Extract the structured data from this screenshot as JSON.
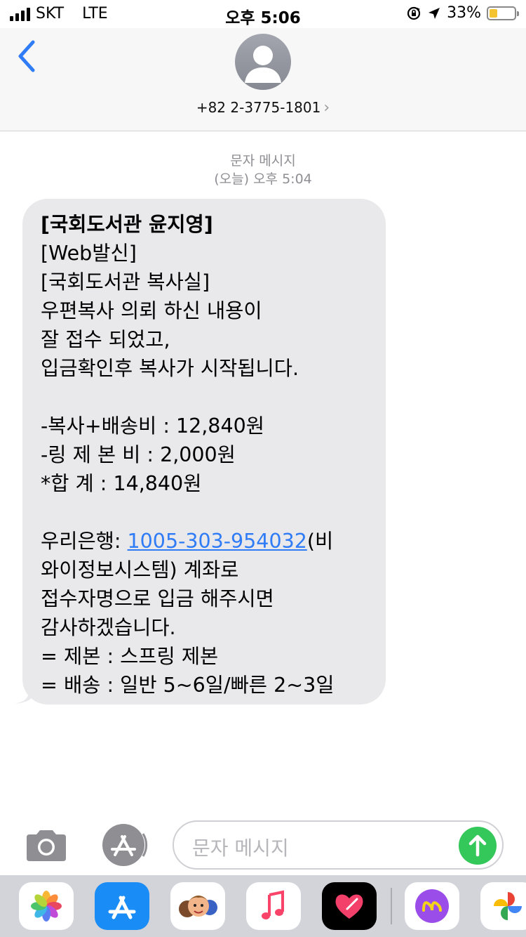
{
  "status": {
    "carrier": "SKT",
    "network": "LTE",
    "time": "오후 5:06",
    "battery_percent": "33%",
    "battery_level": 0.33,
    "battery_color": "#f4c430"
  },
  "header": {
    "back_icon": "chevron-left-icon",
    "avatar_icon": "person-silhouette-icon",
    "contact": "+82 2-3775-1801",
    "contact_chevron": "›",
    "accent": "#2f7cf6"
  },
  "thread": {
    "meta_type": "문자 메시지",
    "meta_time": "(오늘) 오후 5:04",
    "message": {
      "lines": [
        "[국회도서관 윤지영]",
        "[Web발신]",
        "[국회도서관 복사실]",
        "우편복사 의뢰 하신 내용이",
        "잘 접수 되었고,",
        "입금확인후 복사가 시작됩니다.",
        "",
        "-복사+배송비 : 12,840원",
        "-링 제 본 비 : 2,000원",
        "*합       계 : 14,840원",
        "",
        "와이정보시스템) 계좌로",
        "접수자명으로 입금 해주시면",
        "감사하겠습니다.",
        "= 제본 : 스프링 제본",
        "= 배송 : 일반 5~6일/빠른 2~3일"
      ],
      "bank_prefix": "우리은행: ",
      "account_link": "1005-303-954032",
      "bank_suffix": "(비"
    },
    "bubble_color": "#e9e9eb"
  },
  "composer": {
    "placeholder": "문자 메시지",
    "camera_icon": "camera-icon",
    "apps_icon": "app-store-icon",
    "send_icon": "send-arrow-icon",
    "send_color": "#34c759"
  },
  "dock": {
    "apps": [
      "photos-icon",
      "app-store-icon",
      "memoji-icon",
      "music-icon",
      "digital-touch-icon",
      "imessage-app-icon",
      "google-photos-icon"
    ]
  }
}
